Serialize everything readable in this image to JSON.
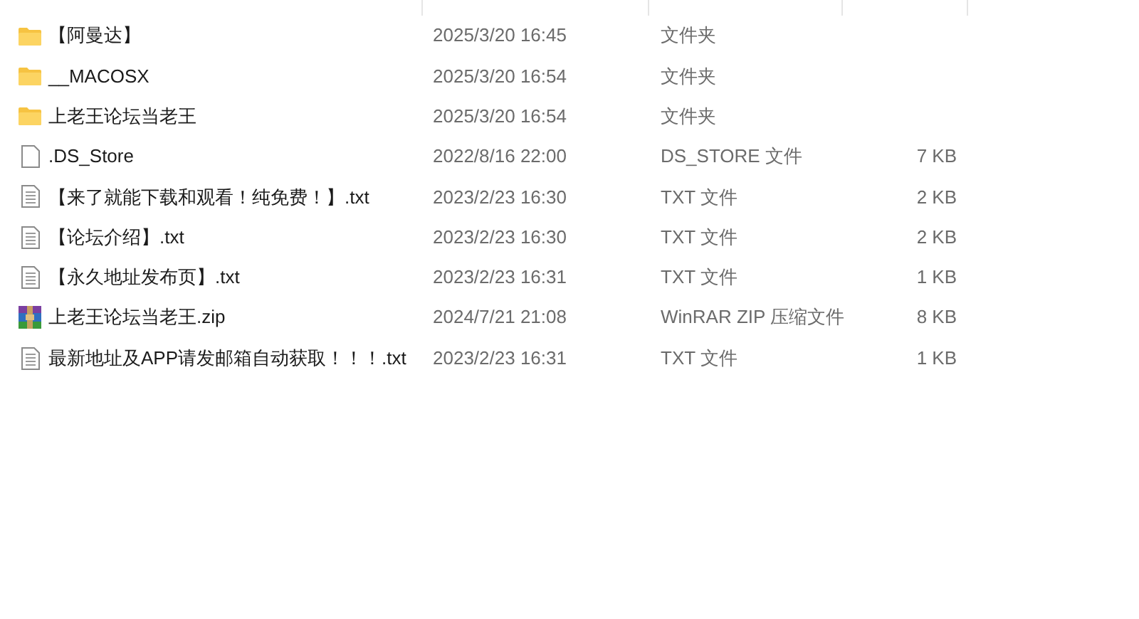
{
  "rows": [
    {
      "kind": "folder",
      "name": "【阿曼达】",
      "date": "2025/3/20 16:45",
      "type": "文件夹"
    },
    {
      "kind": "folder",
      "name": "__MACOSX",
      "date": "2025/3/20 16:54",
      "type": "文件夹"
    },
    {
      "kind": "folder",
      "name": "上老王论坛当老王",
      "date": "2025/3/20 16:54",
      "type": "文件夹"
    },
    {
      "kind": "file",
      "name": ".DS_Store",
      "date": "2022/8/16 22:00",
      "type": "DS_STORE 文件",
      "size": "7 KB"
    },
    {
      "kind": "text",
      "name": "【来了就能下载和观看！纯免费！】.txt",
      "date": "2023/2/23 16:30",
      "type": "TXT 文件",
      "size": "2 KB"
    },
    {
      "kind": "text",
      "name": "【论坛介绍】.txt",
      "date": "2023/2/23 16:30",
      "type": "TXT 文件",
      "size": "2 KB"
    },
    {
      "kind": "text",
      "name": "【永久地址发布页】.txt",
      "date": "2023/2/23 16:31",
      "type": "TXT 文件",
      "size": "1 KB"
    },
    {
      "kind": "zip",
      "name": "上老王论坛当老王.zip",
      "date": "2024/7/21 21:08",
      "type": "WinRAR ZIP 压缩文件",
      "size": "8 KB"
    },
    {
      "kind": "text",
      "name": "最新地址及APP请发邮箱自动获取！！！.txt",
      "date": "2023/2/23 16:31",
      "type": "TXT 文件",
      "size": "1 KB"
    }
  ]
}
